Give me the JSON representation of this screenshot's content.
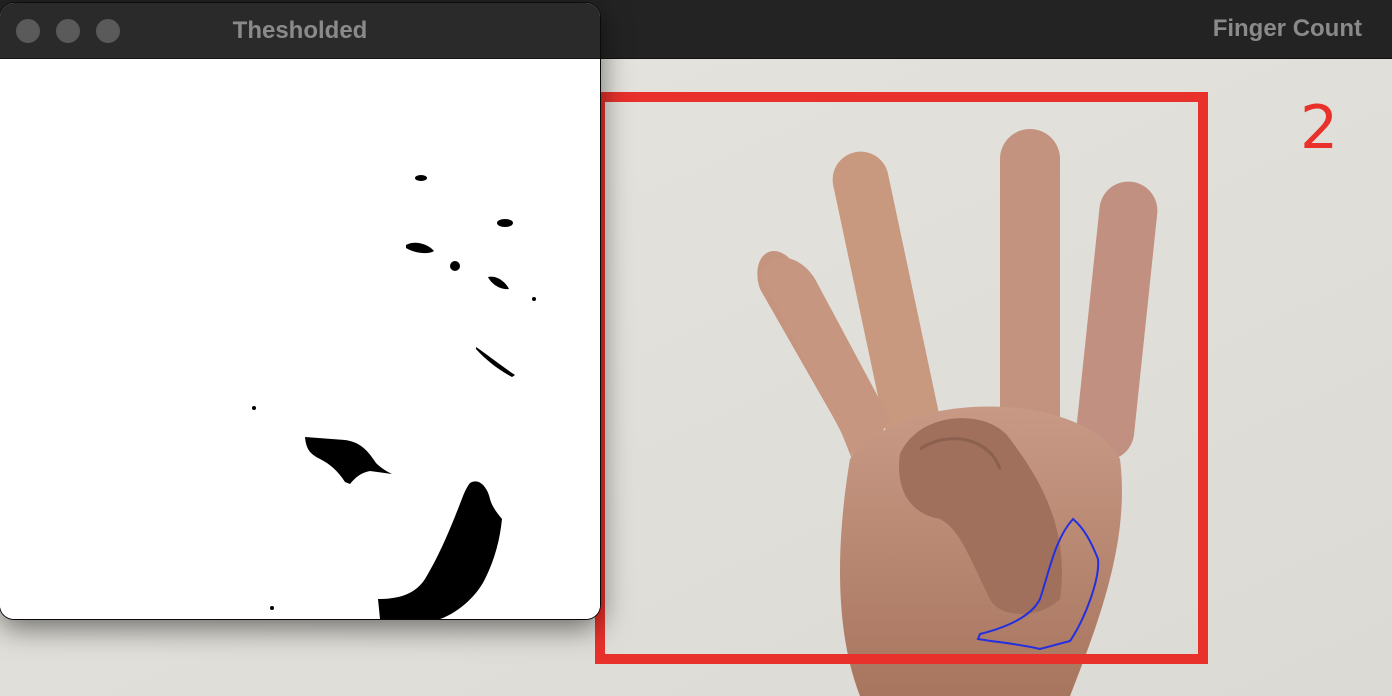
{
  "main_window": {
    "title": "Finger Count",
    "finger_count": "2",
    "roi_box_color": "#e8312a",
    "contour_color": "#2430e0"
  },
  "threshold_window": {
    "title": "Thesholded",
    "buttons": [
      "close-icon",
      "minimize-icon",
      "zoom-icon"
    ]
  }
}
